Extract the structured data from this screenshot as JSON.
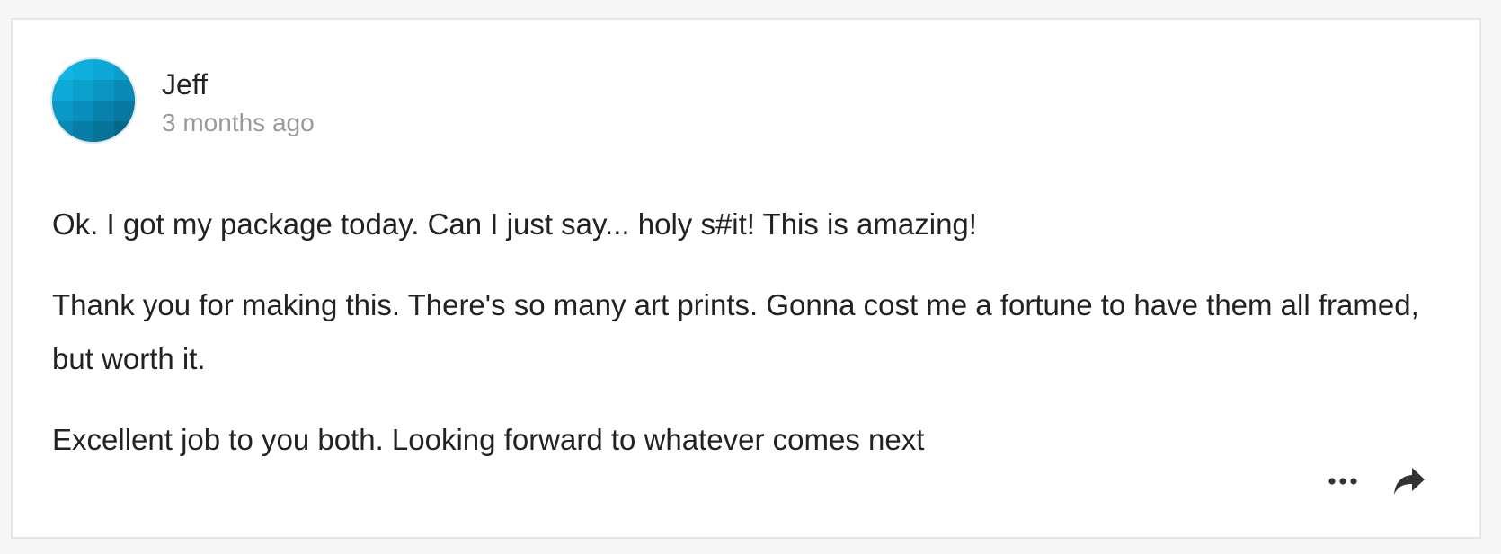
{
  "comment": {
    "author": "Jeff",
    "timestamp": "3 months ago",
    "paragraphs": [
      "Ok. I got my package today. Can I just say... holy s#it! This is amazing!",
      "Thank you for making this. There's so many art prints. Gonna cost me a fortune to have them all framed, but worth it.",
      "Excellent job to you both. Looking forward to whatever comes next"
    ],
    "actions": {
      "more_icon": "more-horizontal-icon",
      "share_icon": "share-arrow-icon"
    }
  },
  "colors": {
    "avatar_primary": "#0aa6d6",
    "avatar_dark": "#056f92",
    "text": "#222222",
    "muted": "#9a9a9a"
  }
}
